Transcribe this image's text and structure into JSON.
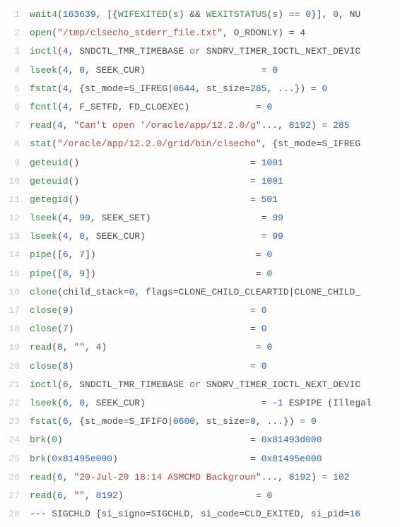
{
  "lines": [
    {
      "n": "1",
      "tokens": [
        {
          "c": "fn",
          "t": "wait4"
        },
        {
          "c": "pl",
          "t": "("
        },
        {
          "c": "num",
          "t": "163639"
        },
        {
          "c": "pl",
          "t": ", [{"
        },
        {
          "c": "fn",
          "t": "WIFEXITED"
        },
        {
          "c": "pl",
          "t": "("
        },
        {
          "c": "fn",
          "t": "s"
        },
        {
          "c": "pl",
          "t": ") && "
        },
        {
          "c": "fn",
          "t": "WEXITSTATUS"
        },
        {
          "c": "pl",
          "t": "("
        },
        {
          "c": "fn",
          "t": "s"
        },
        {
          "c": "pl",
          "t": ") == "
        },
        {
          "c": "num",
          "t": "0"
        },
        {
          "c": "pl",
          "t": "}], "
        },
        {
          "c": "num",
          "t": "0"
        },
        {
          "c": "pl",
          "t": ", NU"
        }
      ]
    },
    {
      "n": "2",
      "tokens": [
        {
          "c": "fn",
          "t": "open"
        },
        {
          "c": "pl",
          "t": "("
        },
        {
          "c": "str",
          "t": "\"/tmp/clsecho_stderr_file.txt\""
        },
        {
          "c": "pl",
          "t": ", O_RDONLY) = "
        },
        {
          "c": "num",
          "t": "4"
        }
      ]
    },
    {
      "n": "3",
      "tokens": [
        {
          "c": "fn",
          "t": "ioctl"
        },
        {
          "c": "pl",
          "t": "("
        },
        {
          "c": "num",
          "t": "4"
        },
        {
          "c": "pl",
          "t": ", SNDCTL_TMR_TIMEBASE "
        },
        {
          "c": "kw",
          "t": "or"
        },
        {
          "c": "pl",
          "t": " SNDRV_TIMER_IOCTL_NEXT_DEVIC"
        }
      ]
    },
    {
      "n": "4",
      "tokens": [
        {
          "c": "fn",
          "t": "lseek"
        },
        {
          "c": "pl",
          "t": "("
        },
        {
          "c": "num",
          "t": "4"
        },
        {
          "c": "pl",
          "t": ", "
        },
        {
          "c": "num",
          "t": "0"
        },
        {
          "c": "pl",
          "t": ", SEEK_CUR)                     = "
        },
        {
          "c": "num",
          "t": "0"
        }
      ]
    },
    {
      "n": "5",
      "tokens": [
        {
          "c": "fn",
          "t": "fstat"
        },
        {
          "c": "pl",
          "t": "("
        },
        {
          "c": "num",
          "t": "4"
        },
        {
          "c": "pl",
          "t": ", {st_mode=S_IFREG|"
        },
        {
          "c": "num",
          "t": "0644"
        },
        {
          "c": "pl",
          "t": ", st_size="
        },
        {
          "c": "num",
          "t": "285"
        },
        {
          "c": "pl",
          "t": ", ...}) = "
        },
        {
          "c": "num",
          "t": "0"
        }
      ]
    },
    {
      "n": "6",
      "tokens": [
        {
          "c": "fn",
          "t": "fcntl"
        },
        {
          "c": "pl",
          "t": "("
        },
        {
          "c": "num",
          "t": "4"
        },
        {
          "c": "pl",
          "t": ", F_SETFD, FD_CLOEXEC)            = "
        },
        {
          "c": "num",
          "t": "0"
        }
      ]
    },
    {
      "n": "7",
      "tokens": [
        {
          "c": "fn",
          "t": "read"
        },
        {
          "c": "pl",
          "t": "("
        },
        {
          "c": "num",
          "t": "4"
        },
        {
          "c": "pl",
          "t": ", "
        },
        {
          "c": "str",
          "t": "\"Can't open '/oracle/app/12.2.0/g\""
        },
        {
          "c": "pl",
          "t": "..., "
        },
        {
          "c": "num",
          "t": "8192"
        },
        {
          "c": "pl",
          "t": ") = "
        },
        {
          "c": "num",
          "t": "285"
        }
      ]
    },
    {
      "n": "8",
      "tokens": [
        {
          "c": "fn",
          "t": "stat"
        },
        {
          "c": "pl",
          "t": "("
        },
        {
          "c": "str",
          "t": "\"/oracle/app/12.2.0/grid/bin/clsecho\""
        },
        {
          "c": "pl",
          "t": ", {st_mode=S_IFREG"
        }
      ]
    },
    {
      "n": "9",
      "tokens": [
        {
          "c": "fn",
          "t": "geteuid"
        },
        {
          "c": "pl",
          "t": "()                               = "
        },
        {
          "c": "num",
          "t": "1001"
        }
      ]
    },
    {
      "n": "10",
      "tokens": [
        {
          "c": "fn",
          "t": "geteuid"
        },
        {
          "c": "pl",
          "t": "()                               = "
        },
        {
          "c": "num",
          "t": "1001"
        }
      ]
    },
    {
      "n": "11",
      "tokens": [
        {
          "c": "fn",
          "t": "getegid"
        },
        {
          "c": "pl",
          "t": "()                               = "
        },
        {
          "c": "num",
          "t": "501"
        }
      ]
    },
    {
      "n": "12",
      "tokens": [
        {
          "c": "fn",
          "t": "lseek"
        },
        {
          "c": "pl",
          "t": "("
        },
        {
          "c": "num",
          "t": "4"
        },
        {
          "c": "pl",
          "t": ", "
        },
        {
          "c": "num",
          "t": "99"
        },
        {
          "c": "pl",
          "t": ", SEEK_SET)                    = "
        },
        {
          "c": "num",
          "t": "99"
        }
      ]
    },
    {
      "n": "13",
      "tokens": [
        {
          "c": "fn",
          "t": "lseek"
        },
        {
          "c": "pl",
          "t": "("
        },
        {
          "c": "num",
          "t": "4"
        },
        {
          "c": "pl",
          "t": ", "
        },
        {
          "c": "num",
          "t": "0"
        },
        {
          "c": "pl",
          "t": ", SEEK_CUR)                     = "
        },
        {
          "c": "num",
          "t": "99"
        }
      ]
    },
    {
      "n": "14",
      "tokens": [
        {
          "c": "fn",
          "t": "pipe"
        },
        {
          "c": "pl",
          "t": "(["
        },
        {
          "c": "num",
          "t": "6"
        },
        {
          "c": "pl",
          "t": ", "
        },
        {
          "c": "num",
          "t": "7"
        },
        {
          "c": "pl",
          "t": "])                             = "
        },
        {
          "c": "num",
          "t": "0"
        }
      ]
    },
    {
      "n": "15",
      "tokens": [
        {
          "c": "fn",
          "t": "pipe"
        },
        {
          "c": "pl",
          "t": "(["
        },
        {
          "c": "num",
          "t": "8"
        },
        {
          "c": "pl",
          "t": ", "
        },
        {
          "c": "num",
          "t": "9"
        },
        {
          "c": "pl",
          "t": "])                             = "
        },
        {
          "c": "num",
          "t": "0"
        }
      ]
    },
    {
      "n": "16",
      "tokens": [
        {
          "c": "fn",
          "t": "clone"
        },
        {
          "c": "pl",
          "t": "(child_stack="
        },
        {
          "c": "num",
          "t": "0"
        },
        {
          "c": "pl",
          "t": ", flags=CLONE_CHILD_CLEARTID|CLONE_CHILD_"
        }
      ]
    },
    {
      "n": "17",
      "tokens": [
        {
          "c": "fn",
          "t": "close"
        },
        {
          "c": "pl",
          "t": "("
        },
        {
          "c": "num",
          "t": "9"
        },
        {
          "c": "pl",
          "t": ")                                = "
        },
        {
          "c": "num",
          "t": "0"
        }
      ]
    },
    {
      "n": "18",
      "tokens": [
        {
          "c": "fn",
          "t": "close"
        },
        {
          "c": "pl",
          "t": "("
        },
        {
          "c": "num",
          "t": "7"
        },
        {
          "c": "pl",
          "t": ")                                = "
        },
        {
          "c": "num",
          "t": "0"
        }
      ]
    },
    {
      "n": "19",
      "tokens": [
        {
          "c": "fn",
          "t": "read"
        },
        {
          "c": "pl",
          "t": "("
        },
        {
          "c": "num",
          "t": "8"
        },
        {
          "c": "pl",
          "t": ", "
        },
        {
          "c": "str",
          "t": "\"\""
        },
        {
          "c": "pl",
          "t": ", "
        },
        {
          "c": "num",
          "t": "4"
        },
        {
          "c": "pl",
          "t": ")                           = "
        },
        {
          "c": "num",
          "t": "0"
        }
      ]
    },
    {
      "n": "20",
      "tokens": [
        {
          "c": "fn",
          "t": "close"
        },
        {
          "c": "pl",
          "t": "("
        },
        {
          "c": "num",
          "t": "8"
        },
        {
          "c": "pl",
          "t": ")                                = "
        },
        {
          "c": "num",
          "t": "0"
        }
      ]
    },
    {
      "n": "21",
      "tokens": [
        {
          "c": "fn",
          "t": "ioctl"
        },
        {
          "c": "pl",
          "t": "("
        },
        {
          "c": "num",
          "t": "6"
        },
        {
          "c": "pl",
          "t": ", SNDCTL_TMR_TIMEBASE "
        },
        {
          "c": "kw",
          "t": "or"
        },
        {
          "c": "pl",
          "t": " SNDRV_TIMER_IOCTL_NEXT_DEVIC"
        }
      ]
    },
    {
      "n": "22",
      "tokens": [
        {
          "c": "fn",
          "t": "lseek"
        },
        {
          "c": "pl",
          "t": "("
        },
        {
          "c": "num",
          "t": "6"
        },
        {
          "c": "pl",
          "t": ", "
        },
        {
          "c": "num",
          "t": "0"
        },
        {
          "c": "pl",
          "t": ", SEEK_CUR)                     = -"
        },
        {
          "c": "num",
          "t": "1"
        },
        {
          "c": "pl",
          "t": " ESPIPE (Illegal "
        }
      ]
    },
    {
      "n": "23",
      "tokens": [
        {
          "c": "fn",
          "t": "fstat"
        },
        {
          "c": "pl",
          "t": "("
        },
        {
          "c": "num",
          "t": "6"
        },
        {
          "c": "pl",
          "t": ", {st_mode=S_IFIFO|"
        },
        {
          "c": "num",
          "t": "0600"
        },
        {
          "c": "pl",
          "t": ", st_size="
        },
        {
          "c": "num",
          "t": "0"
        },
        {
          "c": "pl",
          "t": ", ...}) = "
        },
        {
          "c": "num",
          "t": "0"
        }
      ]
    },
    {
      "n": "24",
      "tokens": [
        {
          "c": "fn",
          "t": "brk"
        },
        {
          "c": "pl",
          "t": "("
        },
        {
          "c": "num",
          "t": "0"
        },
        {
          "c": "pl",
          "t": ")                                  = "
        },
        {
          "c": "num",
          "t": "0x81493d000"
        }
      ]
    },
    {
      "n": "25",
      "tokens": [
        {
          "c": "fn",
          "t": "brk"
        },
        {
          "c": "pl",
          "t": "("
        },
        {
          "c": "num",
          "t": "0x81495e000"
        },
        {
          "c": "pl",
          "t": ")                        = "
        },
        {
          "c": "num",
          "t": "0x81495e000"
        }
      ]
    },
    {
      "n": "26",
      "tokens": [
        {
          "c": "fn",
          "t": "read"
        },
        {
          "c": "pl",
          "t": "("
        },
        {
          "c": "num",
          "t": "6"
        },
        {
          "c": "pl",
          "t": ", "
        },
        {
          "c": "str",
          "t": "\"20-Jul-20 18:14 ASMCMD Backgroun\""
        },
        {
          "c": "pl",
          "t": "..., "
        },
        {
          "c": "num",
          "t": "8192"
        },
        {
          "c": "pl",
          "t": ") = "
        },
        {
          "c": "num",
          "t": "102"
        }
      ]
    },
    {
      "n": "27",
      "tokens": [
        {
          "c": "fn",
          "t": "read"
        },
        {
          "c": "pl",
          "t": "("
        },
        {
          "c": "num",
          "t": "6"
        },
        {
          "c": "pl",
          "t": ", "
        },
        {
          "c": "str",
          "t": "\"\""
        },
        {
          "c": "pl",
          "t": ", "
        },
        {
          "c": "num",
          "t": "8192"
        },
        {
          "c": "pl",
          "t": ")                        = "
        },
        {
          "c": "num",
          "t": "0"
        }
      ]
    },
    {
      "n": "28",
      "tokens": [
        {
          "c": "pl",
          "t": "--- SIGCHLD {si_signo=SIGCHLD, si_code=CLD_EXITED, si_pid="
        },
        {
          "c": "num",
          "t": "16"
        }
      ]
    }
  ]
}
